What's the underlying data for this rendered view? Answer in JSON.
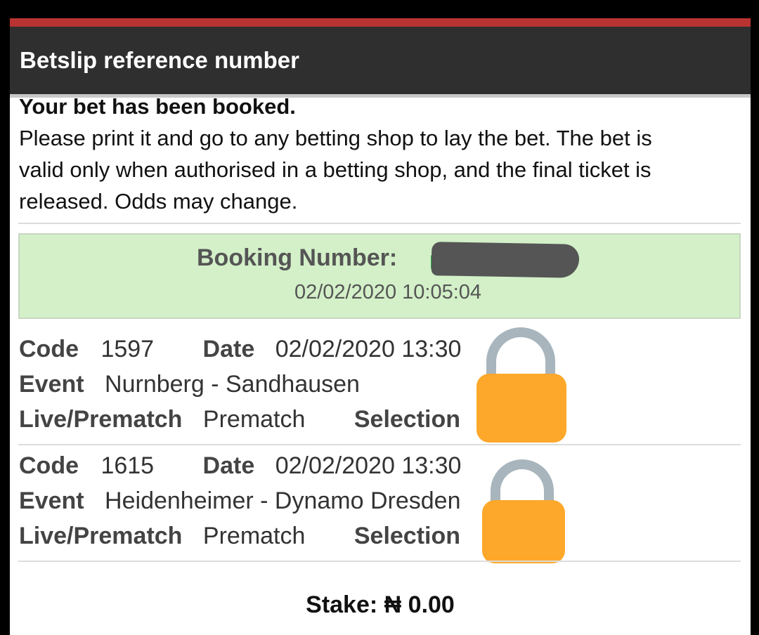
{
  "header": {
    "title": "Betslip reference number",
    "accent_color": "#b83331",
    "bar_color": "#2f2f2f"
  },
  "intro": {
    "headline": "Your bet has been booked.",
    "message_line1": "Please print it and go to any betting shop to lay the bet. The bet is",
    "message_line2": "valid only when authorised in a betting shop, and the final ticket is",
    "message_line3": "released. Odds may change."
  },
  "booking": {
    "label": "Booking Number:",
    "datetime": "02/02/2020 10:05:04",
    "background_color": "#d3f0c8"
  },
  "bets": [
    {
      "code_label": "Code",
      "code": "1597",
      "date_label": "Date",
      "date": "02/02/2020 13:30",
      "event_label": "Event",
      "event": "Nurnberg - Sandhausen",
      "mode_label": "Live/Prematch",
      "mode": "Prematch",
      "selection_label": "Selection",
      "overlay_icon": "padlock-icon"
    },
    {
      "code_label": "Code",
      "code": "1615",
      "date_label": "Date",
      "date": "02/02/2020 13:30",
      "event_label": "Event",
      "event": "Heidenheimer - Dynamo Dresden",
      "mode_label": "Live/Prematch",
      "mode": "Prematch",
      "selection_label": "Selection",
      "overlay_icon": "padlock-icon"
    }
  ],
  "stake": {
    "label": "Stake:",
    "value": "₦ 0.00"
  }
}
